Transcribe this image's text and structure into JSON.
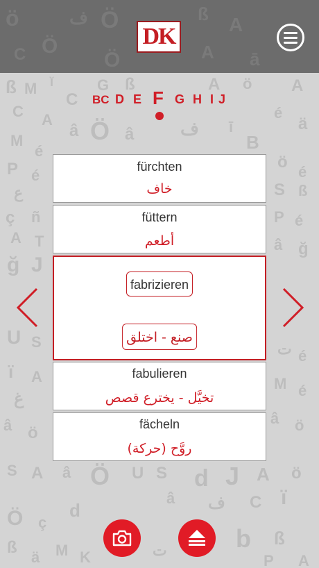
{
  "app": {
    "logo_text": "DK",
    "brand_color": "#c41e24"
  },
  "header": {
    "menu_icon": "hamburger-menu-icon"
  },
  "alphabet": {
    "letters": [
      "BC",
      "D",
      "E",
      "F",
      "G",
      "H",
      "I",
      "J"
    ],
    "selected": "F"
  },
  "entries": [
    {
      "german": "fürchten",
      "arabic": "خاف"
    },
    {
      "german": "füttern",
      "arabic": "أطعم"
    },
    {
      "german": "fabrizieren",
      "arabic": "صنع - اختلق"
    },
    {
      "german": "fabulieren",
      "arabic": "تخيَّل - يخترع قصص"
    },
    {
      "german": "fächeln",
      "arabic": "روَّح (حركة)"
    }
  ],
  "selected_entry_index": 2,
  "nav": {
    "prev_icon": "chevron-left-icon",
    "next_icon": "chevron-right-icon"
  },
  "bottom": {
    "camera_icon": "camera-icon",
    "eject_icon": "eject-icon"
  }
}
